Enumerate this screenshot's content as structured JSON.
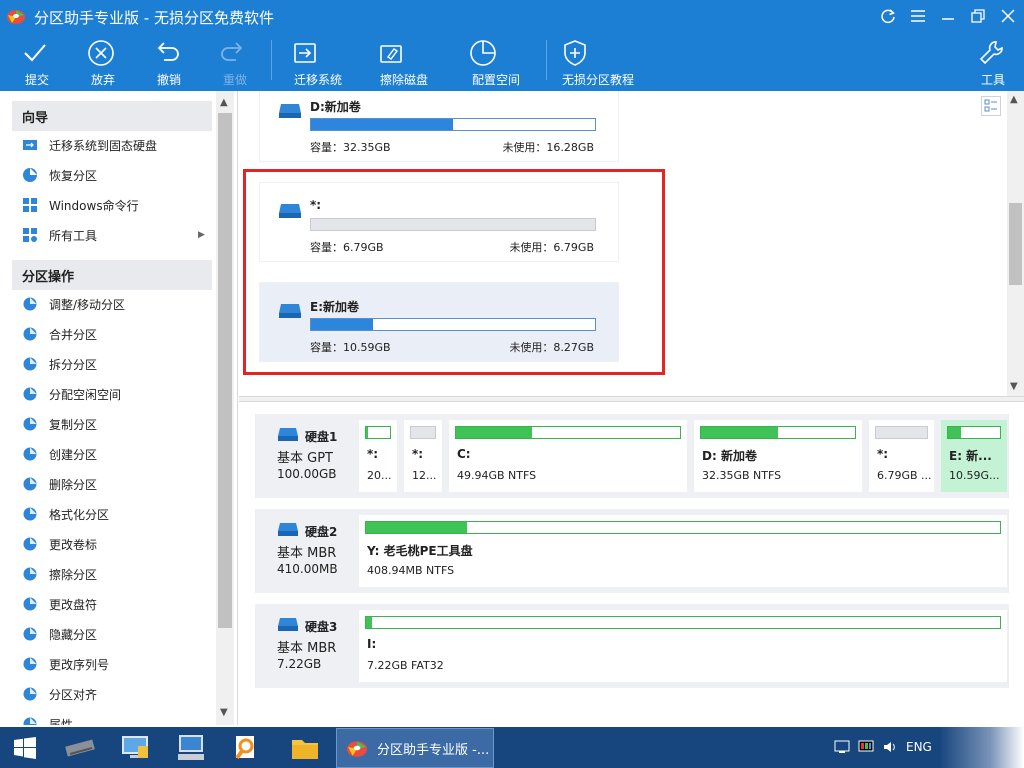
{
  "window": {
    "title": "分区助手专业版 - 无损分区免费软件"
  },
  "toolbar": {
    "submit": "提交",
    "discard": "放弃",
    "undo": "撤销",
    "redo": "重做",
    "migrate": "迁移系统",
    "wipe": "擦除磁盘",
    "allocate": "配置空间",
    "tutorial": "无损分区教程",
    "tools": "工具"
  },
  "sidebar": {
    "wizard_title": "向导",
    "wizard_items": [
      {
        "label": "迁移系统到固态硬盘",
        "icon": "migrate-ssd-icon"
      },
      {
        "label": "恢复分区",
        "icon": "recover-partition-icon"
      },
      {
        "label": "Windows命令行",
        "icon": "windows-icon"
      },
      {
        "label": "所有工具",
        "icon": "all-tools-icon"
      }
    ],
    "ops_title": "分区操作",
    "ops_items": [
      {
        "label": "调整/移动分区"
      },
      {
        "label": "合并分区"
      },
      {
        "label": "拆分分区"
      },
      {
        "label": "分配空闲空间"
      },
      {
        "label": "复制分区"
      },
      {
        "label": "创建分区"
      },
      {
        "label": "删除分区"
      },
      {
        "label": "格式化分区"
      },
      {
        "label": "更改卷标"
      },
      {
        "label": "擦除分区"
      },
      {
        "label": "更改盘符"
      },
      {
        "label": "隐藏分区"
      },
      {
        "label": "更改序列号"
      },
      {
        "label": "分区对齐"
      },
      {
        "label": "属性"
      }
    ]
  },
  "partitions": [
    {
      "name": "D:新加卷",
      "capacity": "容量：32.35GB",
      "free": "未使用：16.28GB",
      "used_fraction": 0.5
    },
    {
      "name": "*:",
      "capacity": "容量：6.79GB",
      "free": "未使用：6.79GB",
      "used_fraction": 0
    },
    {
      "name": "E:新加卷",
      "capacity": "容量：10.59GB",
      "free": "未使用：8.27GB",
      "used_fraction": 0.22
    }
  ],
  "disks": [
    {
      "name": "硬盘1",
      "type": "基本 GPT",
      "size": "100.00GB",
      "parts": [
        {
          "name": "*:",
          "info": "20...",
          "used_fraction": 0.1
        },
        {
          "name": "*:",
          "info": "12...",
          "used_fraction": 0
        },
        {
          "name": "C:",
          "info": "49.94GB NTFS",
          "used_fraction": 0.34
        },
        {
          "name": "D: 新加卷",
          "info": "32.35GB NTFS",
          "used_fraction": 0.5
        },
        {
          "name": "*:",
          "info": "6.79GB ...",
          "used_fraction": 0
        },
        {
          "name": "E: 新...",
          "info": "10.59G...",
          "used_fraction": 0.25
        }
      ]
    },
    {
      "name": "硬盘2",
      "type": "基本 MBR",
      "size": "410.00MB",
      "parts": [
        {
          "name": "Y: 老毛桃PE工具盘",
          "info": "408.94MB NTFS",
          "used_fraction": 0.16
        }
      ]
    },
    {
      "name": "硬盘3",
      "type": "基本 MBR",
      "size": "7.22GB",
      "parts": [
        {
          "name": "I:",
          "info": "7.22GB FAT32",
          "used_fraction": 0.01
        }
      ]
    }
  ],
  "taskbar": {
    "active_window": "分区助手专业版 -...",
    "language": "ENG"
  },
  "colors": {
    "accent": "#1c7fd4",
    "used_bar": "#2d86dd",
    "disk_bar": "#3fc356",
    "highlight": "#e32424"
  }
}
